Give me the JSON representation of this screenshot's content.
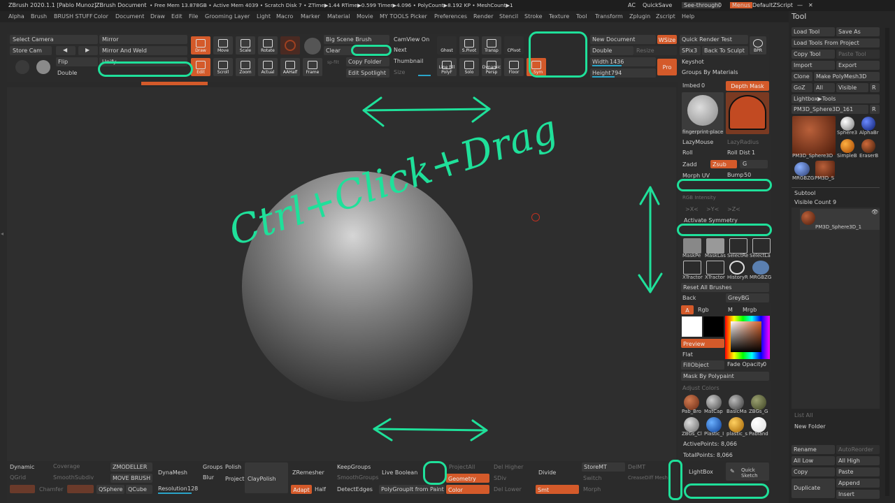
{
  "title_bar": {
    "app": "ZBrush 2020.1.1 [Pablo Munoz]",
    "doc": "ZBrush Document",
    "stats": "• Free Mem 13.878GB • Active Mem 4039 • Scratch Disk 7 • ZTime▶1.44 RTime▶0.599 Timer▶4.096 • PolyCount▶8.192 KP • MeshCount▶1",
    "ac": "AC",
    "quicksave": "QuickSave",
    "seethrough": "See-through",
    "seethrough_val": "0",
    "menus": "Menus",
    "script": "DefaultZScript"
  },
  "menu": [
    "Alpha",
    "Brush",
    "BRUSH STUFF",
    "Color",
    "Document",
    "Draw",
    "Edit",
    "File",
    "Grooming",
    "Layer",
    "Light",
    "Macro",
    "Marker",
    "Material",
    "Movie",
    "MY TOOLS",
    "Picker",
    "Preferences",
    "Render",
    "Stencil",
    "Stroke",
    "Texture",
    "Tool",
    "Transform",
    "Zplugin",
    "Zscript",
    "Help"
  ],
  "shelf": {
    "select_camera": "Select Camera",
    "store_cam": "Store Cam",
    "mirror": "Mirror",
    "mirror_weld": "Mirror And Weld",
    "unify": "Unify",
    "flip": "Flip",
    "double": "Double",
    "draw": "Draw",
    "move": "Move",
    "scale": "Scale",
    "rotate": "Rotate",
    "edit": "Edit",
    "scroll": "Scroll",
    "zoom": "Zoom",
    "actual": "Actual",
    "aahalf": "AAHalf",
    "frame": "Frame",
    "big_scene_brush": "Big Scene Brush",
    "clear": "Clear",
    "camview_on": "CamView On",
    "next": "Next",
    "thumbnail": "Thumbnail",
    "copy_folder": "Copy Folder",
    "edit_spotlight": "Edit Spotlight",
    "size": "Size",
    "spfilt": "sp-filt",
    "spivot": "S.Pivot",
    "transp": "Transp",
    "cpivot": "CPivot",
    "ghost": "Ghost",
    "linefill": "Line Fill PolyF",
    "solo": "Solo",
    "persp": "Dynamic Persp",
    "floor": "Floor",
    "lsym": "L.Sym",
    "new_document": "New Document",
    "wsize": "WSize",
    "double2": "Double",
    "resize": "Resize",
    "width": "Width",
    "width_val": "1436",
    "height": "Height",
    "height_val": "794",
    "pro": "Pro",
    "quick_render": "Quick Render Test",
    "spix": "SPix",
    "spix_val": "3",
    "back_to_sculpt": "Back To Sculpt",
    "bpr": "BPR",
    "keyshot": "Keyshot",
    "groups_by_materials": "Groups By Materials"
  },
  "rpanel": {
    "imbed": "Imbed",
    "imbed_val": "0",
    "depth_mask": "Depth Mask",
    "alpha_name": "fingerprint-place",
    "lazymouse": "LazyMouse",
    "lazyradius": "LazyRadius",
    "roll": "Roll",
    "roll_dist": "Roll Dist",
    "roll_dist_val": "1",
    "zadd": "Zadd",
    "zsub": "Zsub",
    "g": "G",
    "morph_uv": "Morph UV",
    "bump": "Bump",
    "bump_val": "50",
    "rgb_intensity": "RGB Intensity",
    "activate_symmetry": "Activate Symmetry",
    "x": ">X<",
    "y": ">Y<",
    "z": ">Z<",
    "brushes": [
      "MaskPe",
      "MaskLas",
      "SelectRe",
      "SelectLa",
      "XTractor",
      "XTractor",
      "HistoryR",
      "MRGBZG"
    ],
    "reset_all_brushes": "Reset All Brushes",
    "back": "Back",
    "greybg": "GreyBG",
    "a": "A",
    "rgb": "Rgb",
    "m": "M",
    "mrgb": "Mrgb",
    "preview": "Preview",
    "flat": "Flat",
    "fillobject": "FillObject",
    "fade_opacity": "Fade Opacity",
    "fade_val": "0",
    "mask_by_polypaint": "Mask By Polypaint",
    "adjust_colors": "Adjust Colors",
    "materials": [
      "Pab_Bro",
      "MatCap",
      "BasicMa",
      "ZBGs_G",
      "ZBGs_Cl",
      "Plastic_I",
      "plastic_s",
      "Pabland"
    ],
    "active_points": "ActivePoints: 8,066",
    "total_points": "TotalPoints: 8,066"
  },
  "bottom": {
    "dynamic": "Dynamic",
    "coverage": "Coverage",
    "qgrid": "QGrid",
    "smoothsubdiv": "SmoothSubdiv",
    "chamfer": "Chamfer",
    "zmodeller": "ZMODELLER",
    "move_brush": "MOVE BRUSH",
    "qsphere": "QSphere",
    "qcube": "QCube",
    "dynamesh": "DynaMesh",
    "groups": "Groups",
    "polish": "Polish",
    "blur": "Blur",
    "project": "Project",
    "claypolish": "ClayPolish",
    "resolution": "Resolution",
    "resolution_val": "128",
    "zremesher": "ZRemesher",
    "adapt": "Adapt",
    "half": "Half",
    "keepgroups": "KeepGroups",
    "smoothgroups": "SmoothGroups",
    "detectedges": "DetectEdges",
    "live_boolean": "Live Boolean",
    "polygroupit": "PolyGroupIt from Paint",
    "projectall": "ProjectAll",
    "geometry": "Geometry",
    "color": "Color",
    "del_higher": "Del Higher",
    "sdiv": "SDiv",
    "del_lower": "Del Lower",
    "divide": "Divide",
    "smt": "Smt",
    "storemt": "StoreMT",
    "delmt": "DelMT",
    "switch": "Switch",
    "creasediff": "CreaseDiff Mesh",
    "morph": "Morph",
    "lightbox": "LightBox",
    "quick_sketch": "Quick Sketch"
  },
  "tool": {
    "title": "Tool",
    "load_tool": "Load Tool",
    "save_as": "Save As",
    "load_from_project": "Load Tools From Project",
    "copy_tool": "Copy Tool",
    "paste_tool": "Paste Tool",
    "import": "Import",
    "export": "Export",
    "clone": "Clone",
    "make_polymesh": "Make PolyMesh3D",
    "goz": "GoZ",
    "all": "All",
    "visible": "Visible",
    "r": "R",
    "lightbox_tools": "Lightbox▶Tools",
    "current_tool": "PM3D_Sphere3D_1.",
    "current_val": "61",
    "thumbs": [
      "PM3D_Sphere3D",
      "Sphere3",
      "AlphaBr",
      "SimpleB",
      "EraserB",
      "MRGBZG",
      "PM3D_S"
    ],
    "subtool": "Subtool",
    "visible_count": "Visible Count 9",
    "subtool_name": "PM3D_Sphere3D_1",
    "list_all": "List All",
    "new_folder": "New Folder",
    "rename": "Rename",
    "autoreorder": "AutoReorder",
    "all_low": "All Low",
    "all_high": "All High",
    "copy": "Copy",
    "paste": "Paste",
    "duplicate": "Duplicate",
    "append": "Append",
    "insert": "Insert"
  },
  "annotation": "Ctrl+Click+Drag",
  "colors": {
    "accent": "#d45a2a",
    "annot": "#1fe09a"
  }
}
